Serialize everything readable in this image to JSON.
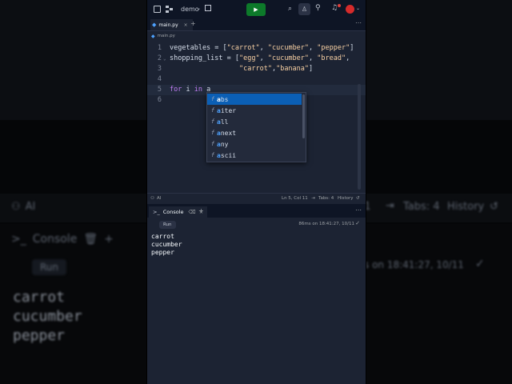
{
  "topbar": {
    "project_name": "demo",
    "run_label": "▶"
  },
  "editor_tabs": [
    {
      "label": "main.py"
    }
  ],
  "breadcrumb": {
    "file": "main.py"
  },
  "code": [
    {
      "num": "1",
      "parts": [
        {
          "t": "vegetables = [",
          "c": ""
        },
        {
          "t": "\"carrot\"",
          "c": "str"
        },
        {
          "t": ", ",
          "c": ""
        },
        {
          "t": "\"cucumber\"",
          "c": "str"
        },
        {
          "t": ", ",
          "c": ""
        },
        {
          "t": "\"pepper\"",
          "c": "str"
        },
        {
          "t": "]",
          "c": ""
        }
      ]
    },
    {
      "num": "2",
      "parts": [
        {
          "t": "shopping_list = [",
          "c": ""
        },
        {
          "t": "\"egg\"",
          "c": "str"
        },
        {
          "t": ", ",
          "c": ""
        },
        {
          "t": "\"cucumber\"",
          "c": "str"
        },
        {
          "t": ", ",
          "c": ""
        },
        {
          "t": "\"bread\"",
          "c": "str"
        },
        {
          "t": ",",
          "c": ""
        }
      ]
    },
    {
      "num": "3",
      "parts": [
        {
          "t": "                 ",
          "c": ""
        },
        {
          "t": "\"carrot\"",
          "c": "str"
        },
        {
          "t": ",",
          "c": ""
        },
        {
          "t": "\"banana\"",
          "c": "str"
        },
        {
          "t": "]",
          "c": ""
        }
      ]
    },
    {
      "num": "4",
      "parts": [
        {
          "t": "",
          "c": ""
        }
      ]
    },
    {
      "num": "5",
      "parts": [
        {
          "t": "for",
          "c": "kw"
        },
        {
          "t": " i ",
          "c": ""
        },
        {
          "t": "in",
          "c": "kw"
        },
        {
          "t": " a",
          "c": ""
        }
      ]
    },
    {
      "num": "6",
      "parts": [
        {
          "t": "",
          "c": ""
        }
      ]
    }
  ],
  "autocomplete": [
    {
      "kind": "f",
      "match": "a",
      "rest": "bs"
    },
    {
      "kind": "f",
      "match": "a",
      "rest": "iter"
    },
    {
      "kind": "f",
      "match": "a",
      "rest": "ll"
    },
    {
      "kind": "f",
      "match": "a",
      "rest": "next"
    },
    {
      "kind": "f",
      "match": "a",
      "rest": "ny"
    },
    {
      "kind": "f",
      "match": "a",
      "rest": "scii"
    }
  ],
  "status": {
    "ai": "AI",
    "position": "Ln 5, Col 11",
    "tabs": "Tabs: 4",
    "history": "History"
  },
  "console": {
    "tab_label": "Console",
    "run_chip": "Run",
    "meta": "86ms on 18:41:27, 10/11",
    "output": [
      "carrot",
      "cucumber",
      "pepper"
    ]
  },
  "background": {
    "ai": "AI",
    "col": "11",
    "tabs": "Tabs: 4",
    "history": "History",
    "console": "Console",
    "run": "Run",
    "meta": "s on 18:41:27, 10/11",
    "output": [
      "carrot",
      "cucumber",
      "pepper"
    ]
  },
  "colors": {
    "accent": "#0b5fb5",
    "run": "#0d7a2a",
    "panel": "#1c2333",
    "topbar": "#0e1525"
  }
}
